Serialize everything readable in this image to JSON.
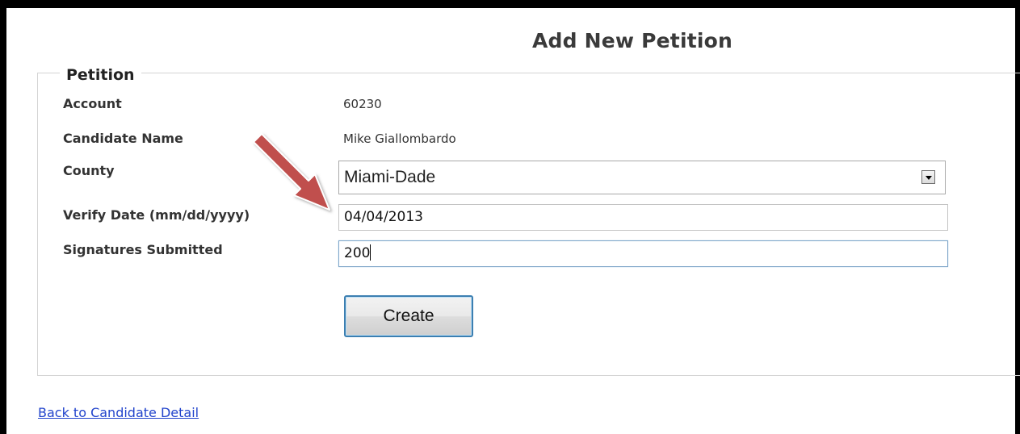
{
  "page": {
    "title": "Add New Petition"
  },
  "petition": {
    "legend": "Petition",
    "account": {
      "label": "Account",
      "value": "60230"
    },
    "candidate_name": {
      "label": "Candidate Name",
      "value": "Mike Giallombardo"
    },
    "county": {
      "label": "County",
      "selected": "Miami-Dade"
    },
    "verify_date": {
      "label": "Verify Date (mm/dd/yyyy)",
      "value": "04/04/2013"
    },
    "signatures_submitted": {
      "label": "Signatures Submitted",
      "value": "200"
    },
    "create_label": "Create"
  },
  "back_link": "Back to Candidate Detail",
  "annotation": {
    "icon": "red-arrow",
    "color": "#c0504d"
  }
}
